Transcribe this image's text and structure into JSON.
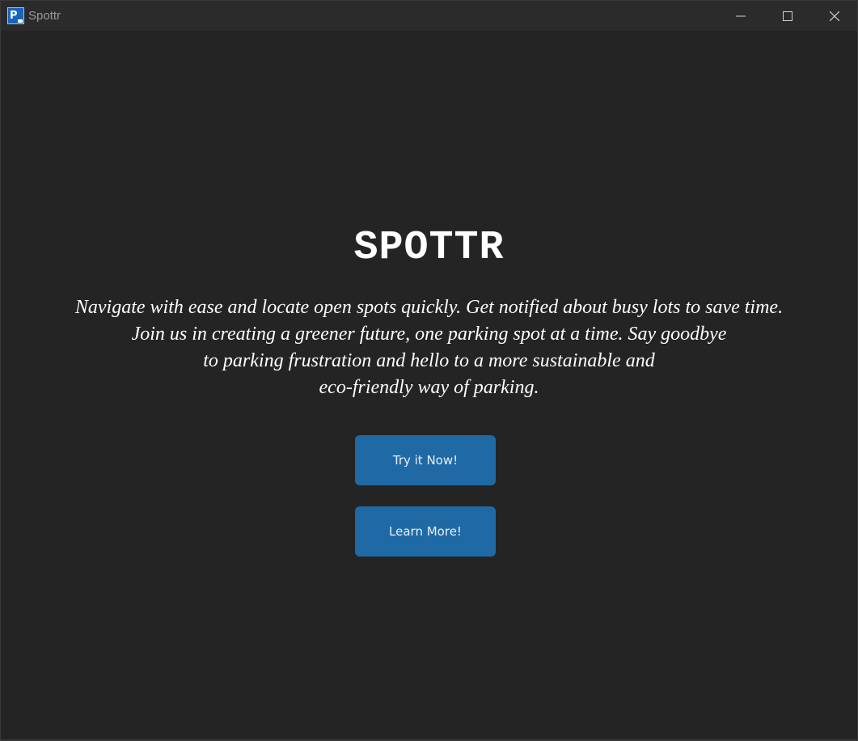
{
  "window": {
    "title": "Spottr",
    "icon": "parking-app-icon",
    "icon_letter": "P"
  },
  "controls": {
    "minimize_icon": "minimize-icon",
    "maximize_icon": "maximize-icon",
    "close_icon": "close-icon"
  },
  "hero": {
    "headline": "SPOTTR",
    "tagline_lines": [
      "Navigate with ease and locate open spots quickly. Get notified about busy lots to save time.",
      "Join us in creating a greener future, one parking spot at a time. Say goodbye",
      "to parking frustration and hello to a more sustainable and",
      "eco-friendly way of parking."
    ]
  },
  "buttons": {
    "try_label": "Try it Now!",
    "learn_label": "Learn More!"
  },
  "colors": {
    "background": "#242424",
    "titlebar": "#2b2b2b",
    "button": "#1f6aa5",
    "text": "#ffffff"
  }
}
